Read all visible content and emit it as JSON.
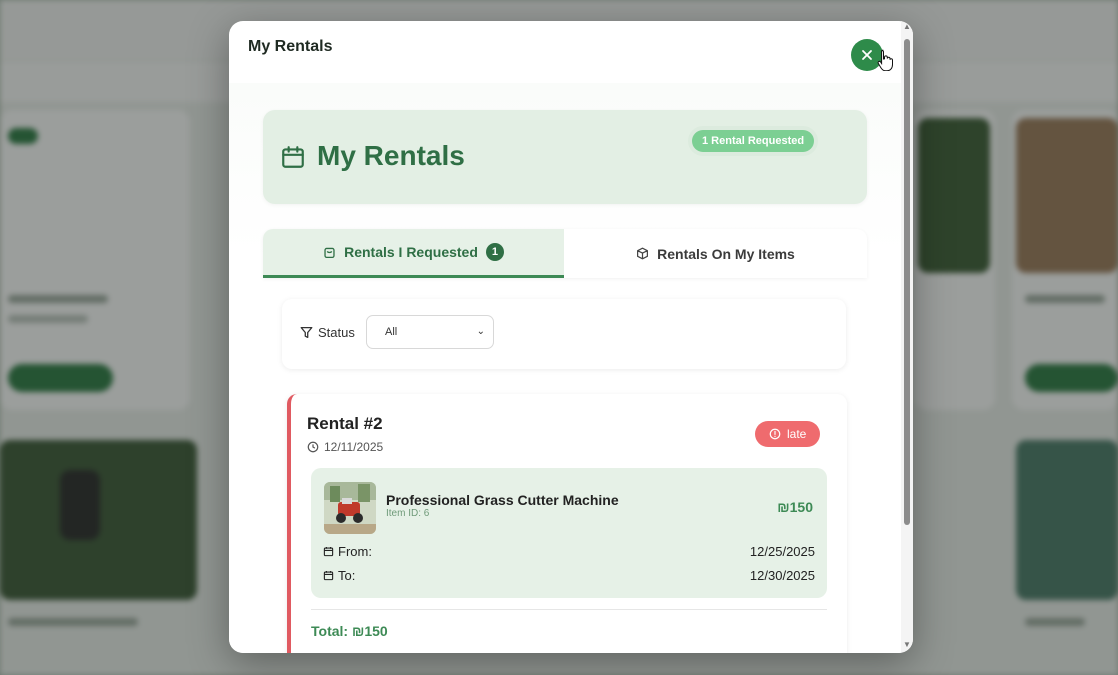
{
  "modal": {
    "title": "My Rentals",
    "close_icon": "close-icon"
  },
  "hero": {
    "title": "My Rentals",
    "icon": "calendar-icon",
    "badge": "1 Rental Requested"
  },
  "tabs": [
    {
      "label": "Rentals I Requested",
      "count": "1",
      "icon": "bag-icon",
      "active": true
    },
    {
      "label": "Rentals On My Items",
      "icon": "box-icon",
      "active": false
    }
  ],
  "filter": {
    "label": "Status",
    "icon": "filter-icon",
    "selected": "All"
  },
  "rental": {
    "title": "Rental #2",
    "date": "12/11/2025",
    "status": "late",
    "item": {
      "name": "Professional Grass Cutter Machine",
      "id_label": "Item ID: 6",
      "price": "₪150"
    },
    "from_label": "From:",
    "from_date": "12/25/2025",
    "to_label": "To:",
    "to_date": "12/30/2025",
    "total": "Total: ₪150"
  },
  "colors": {
    "accent": "#2f6f45",
    "late": "#ef6b6e",
    "hero_bg": "#e3efe4"
  }
}
